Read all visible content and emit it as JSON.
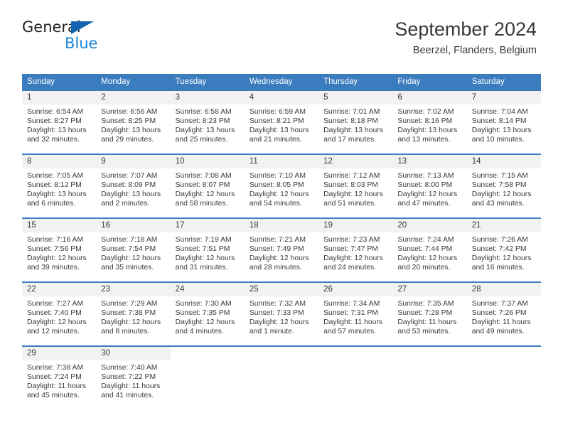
{
  "logo": {
    "line1": "General",
    "line2": "Blue",
    "triangle_color": "#1263b0",
    "blue_color": "#1b87d4"
  },
  "header": {
    "title": "September 2024",
    "subtitle": "Beerzel, Flanders, Belgium"
  },
  "theme": {
    "header_blue": "#3a7cbe",
    "daynum_bg": "#f2f2f2",
    "text": "#3a3a3a"
  },
  "weekdays": [
    "Sunday",
    "Monday",
    "Tuesday",
    "Wednesday",
    "Thursday",
    "Friday",
    "Saturday"
  ],
  "weeks": [
    [
      {
        "day": "1",
        "sunrise": "Sunrise: 6:54 AM",
        "sunset": "Sunset: 8:27 PM",
        "daylight1": "Daylight: 13 hours",
        "daylight2": "and 32 minutes."
      },
      {
        "day": "2",
        "sunrise": "Sunrise: 6:56 AM",
        "sunset": "Sunset: 8:25 PM",
        "daylight1": "Daylight: 13 hours",
        "daylight2": "and 29 minutes."
      },
      {
        "day": "3",
        "sunrise": "Sunrise: 6:58 AM",
        "sunset": "Sunset: 8:23 PM",
        "daylight1": "Daylight: 13 hours",
        "daylight2": "and 25 minutes."
      },
      {
        "day": "4",
        "sunrise": "Sunrise: 6:59 AM",
        "sunset": "Sunset: 8:21 PM",
        "daylight1": "Daylight: 13 hours",
        "daylight2": "and 21 minutes."
      },
      {
        "day": "5",
        "sunrise": "Sunrise: 7:01 AM",
        "sunset": "Sunset: 8:18 PM",
        "daylight1": "Daylight: 13 hours",
        "daylight2": "and 17 minutes."
      },
      {
        "day": "6",
        "sunrise": "Sunrise: 7:02 AM",
        "sunset": "Sunset: 8:16 PM",
        "daylight1": "Daylight: 13 hours",
        "daylight2": "and 13 minutes."
      },
      {
        "day": "7",
        "sunrise": "Sunrise: 7:04 AM",
        "sunset": "Sunset: 8:14 PM",
        "daylight1": "Daylight: 13 hours",
        "daylight2": "and 10 minutes."
      }
    ],
    [
      {
        "day": "8",
        "sunrise": "Sunrise: 7:05 AM",
        "sunset": "Sunset: 8:12 PM",
        "daylight1": "Daylight: 13 hours",
        "daylight2": "and 6 minutes."
      },
      {
        "day": "9",
        "sunrise": "Sunrise: 7:07 AM",
        "sunset": "Sunset: 8:09 PM",
        "daylight1": "Daylight: 13 hours",
        "daylight2": "and 2 minutes."
      },
      {
        "day": "10",
        "sunrise": "Sunrise: 7:08 AM",
        "sunset": "Sunset: 8:07 PM",
        "daylight1": "Daylight: 12 hours",
        "daylight2": "and 58 minutes."
      },
      {
        "day": "11",
        "sunrise": "Sunrise: 7:10 AM",
        "sunset": "Sunset: 8:05 PM",
        "daylight1": "Daylight: 12 hours",
        "daylight2": "and 54 minutes."
      },
      {
        "day": "12",
        "sunrise": "Sunrise: 7:12 AM",
        "sunset": "Sunset: 8:03 PM",
        "daylight1": "Daylight: 12 hours",
        "daylight2": "and 51 minutes."
      },
      {
        "day": "13",
        "sunrise": "Sunrise: 7:13 AM",
        "sunset": "Sunset: 8:00 PM",
        "daylight1": "Daylight: 12 hours",
        "daylight2": "and 47 minutes."
      },
      {
        "day": "14",
        "sunrise": "Sunrise: 7:15 AM",
        "sunset": "Sunset: 7:58 PM",
        "daylight1": "Daylight: 12 hours",
        "daylight2": "and 43 minutes."
      }
    ],
    [
      {
        "day": "15",
        "sunrise": "Sunrise: 7:16 AM",
        "sunset": "Sunset: 7:56 PM",
        "daylight1": "Daylight: 12 hours",
        "daylight2": "and 39 minutes."
      },
      {
        "day": "16",
        "sunrise": "Sunrise: 7:18 AM",
        "sunset": "Sunset: 7:54 PM",
        "daylight1": "Daylight: 12 hours",
        "daylight2": "and 35 minutes."
      },
      {
        "day": "17",
        "sunrise": "Sunrise: 7:19 AM",
        "sunset": "Sunset: 7:51 PM",
        "daylight1": "Daylight: 12 hours",
        "daylight2": "and 31 minutes."
      },
      {
        "day": "18",
        "sunrise": "Sunrise: 7:21 AM",
        "sunset": "Sunset: 7:49 PM",
        "daylight1": "Daylight: 12 hours",
        "daylight2": "and 28 minutes."
      },
      {
        "day": "19",
        "sunrise": "Sunrise: 7:23 AM",
        "sunset": "Sunset: 7:47 PM",
        "daylight1": "Daylight: 12 hours",
        "daylight2": "and 24 minutes."
      },
      {
        "day": "20",
        "sunrise": "Sunrise: 7:24 AM",
        "sunset": "Sunset: 7:44 PM",
        "daylight1": "Daylight: 12 hours",
        "daylight2": "and 20 minutes."
      },
      {
        "day": "21",
        "sunrise": "Sunrise: 7:26 AM",
        "sunset": "Sunset: 7:42 PM",
        "daylight1": "Daylight: 12 hours",
        "daylight2": "and 16 minutes."
      }
    ],
    [
      {
        "day": "22",
        "sunrise": "Sunrise: 7:27 AM",
        "sunset": "Sunset: 7:40 PM",
        "daylight1": "Daylight: 12 hours",
        "daylight2": "and 12 minutes."
      },
      {
        "day": "23",
        "sunrise": "Sunrise: 7:29 AM",
        "sunset": "Sunset: 7:38 PM",
        "daylight1": "Daylight: 12 hours",
        "daylight2": "and 8 minutes."
      },
      {
        "day": "24",
        "sunrise": "Sunrise: 7:30 AM",
        "sunset": "Sunset: 7:35 PM",
        "daylight1": "Daylight: 12 hours",
        "daylight2": "and 4 minutes."
      },
      {
        "day": "25",
        "sunrise": "Sunrise: 7:32 AM",
        "sunset": "Sunset: 7:33 PM",
        "daylight1": "Daylight: 12 hours",
        "daylight2": "and 1 minute."
      },
      {
        "day": "26",
        "sunrise": "Sunrise: 7:34 AM",
        "sunset": "Sunset: 7:31 PM",
        "daylight1": "Daylight: 11 hours",
        "daylight2": "and 57 minutes."
      },
      {
        "day": "27",
        "sunrise": "Sunrise: 7:35 AM",
        "sunset": "Sunset: 7:28 PM",
        "daylight1": "Daylight: 11 hours",
        "daylight2": "and 53 minutes."
      },
      {
        "day": "28",
        "sunrise": "Sunrise: 7:37 AM",
        "sunset": "Sunset: 7:26 PM",
        "daylight1": "Daylight: 11 hours",
        "daylight2": "and 49 minutes."
      }
    ],
    [
      {
        "day": "29",
        "sunrise": "Sunrise: 7:38 AM",
        "sunset": "Sunset: 7:24 PM",
        "daylight1": "Daylight: 11 hours",
        "daylight2": "and 45 minutes."
      },
      {
        "day": "30",
        "sunrise": "Sunrise: 7:40 AM",
        "sunset": "Sunset: 7:22 PM",
        "daylight1": "Daylight: 11 hours",
        "daylight2": "and 41 minutes."
      },
      {
        "day": "",
        "sunrise": "",
        "sunset": "",
        "daylight1": "",
        "daylight2": ""
      },
      {
        "day": "",
        "sunrise": "",
        "sunset": "",
        "daylight1": "",
        "daylight2": ""
      },
      {
        "day": "",
        "sunrise": "",
        "sunset": "",
        "daylight1": "",
        "daylight2": ""
      },
      {
        "day": "",
        "sunrise": "",
        "sunset": "",
        "daylight1": "",
        "daylight2": ""
      },
      {
        "day": "",
        "sunrise": "",
        "sunset": "",
        "daylight1": "",
        "daylight2": ""
      }
    ]
  ]
}
